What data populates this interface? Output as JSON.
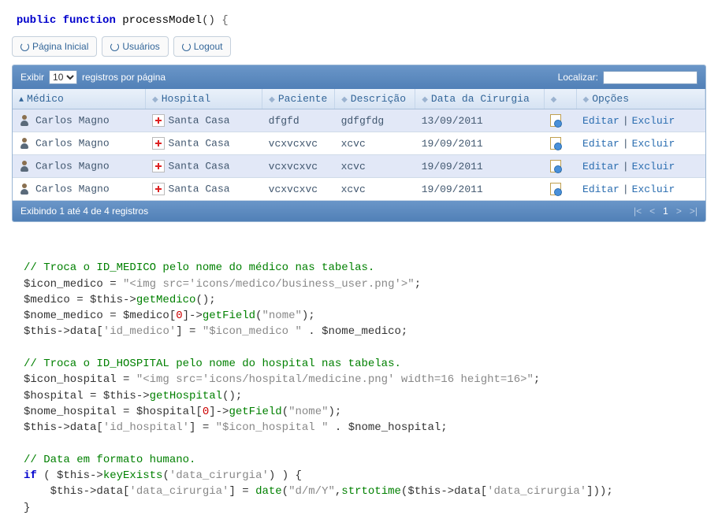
{
  "signature": {
    "public": "public",
    "function": "function",
    "name": "processModel",
    "parens": "()",
    "brace": " {"
  },
  "nav": {
    "home": "Página Inicial",
    "users": "Usuários",
    "logout": "Logout"
  },
  "datatable": {
    "show_label": "Exibir",
    "page_size": "10",
    "per_page": "registros por página",
    "search_label": "Localizar:",
    "search_value": "",
    "headers": {
      "medico": "Médico",
      "hospital": "Hospital",
      "paciente": "Paciente",
      "descricao": "Descrição",
      "data": "Data da Cirurgia",
      "opcoes": "Opções"
    },
    "rows": [
      {
        "medico": "Carlos Magno",
        "hospital": "Santa Casa",
        "paciente": "dfgfd",
        "descricao": "gdfgfdg",
        "data": "13/09/2011",
        "edit": "Editar",
        "del": "Excluir"
      },
      {
        "medico": "Carlos Magno",
        "hospital": "Santa Casa",
        "paciente": "vcxvcxvc",
        "descricao": "xcvc",
        "data": "19/09/2011",
        "edit": "Editar",
        "del": "Excluir"
      },
      {
        "medico": "Carlos Magno",
        "hospital": "Santa Casa",
        "paciente": "vcxvcxvc",
        "descricao": "xcvc",
        "data": "19/09/2011",
        "edit": "Editar",
        "del": "Excluir"
      },
      {
        "medico": "Carlos Magno",
        "hospital": "Santa Casa",
        "paciente": "vcxvcxvc",
        "descricao": "xcvc",
        "data": "19/09/2011",
        "edit": "Editar",
        "del": "Excluir"
      }
    ],
    "footer_info": "Exibindo 1 até 4 de 4 registros",
    "pager": {
      "first": "|<",
      "prev": "<",
      "current": "1",
      "next": ">",
      "last": ">|"
    }
  },
  "code": {
    "l01": "// Troca o ID_MEDICO pelo nome do médico nas tabelas.",
    "l02a": "$icon_medico = ",
    "l02b": "\"<img src='icons/medico/business_user.png'>\"",
    "l02c": ";",
    "l03a": "$medico = $this->",
    "l03b": "getMedico",
    "l03c": "();",
    "l04a": "$nome_medico = $medico[",
    "l04b": "0",
    "l04c": "]->",
    "l04d": "getField",
    "l04e": "(",
    "l04f": "\"nome\"",
    "l04g": ");",
    "l05a": "$this->data[",
    "l05b": "'id_medico'",
    "l05c": "] = ",
    "l05d": "\"$icon_medico \"",
    "l05e": " . $nome_medico;",
    "l06": "",
    "l07": "// Troca o ID_HOSPITAL pelo nome do hospital nas tabelas.",
    "l08a": "$icon_hospital = ",
    "l08b": "\"<img src='icons/hospital/medicine.png' width=16 height=16>\"",
    "l08c": ";",
    "l09a": "$hospital = $this->",
    "l09b": "getHospital",
    "l09c": "();",
    "l10a": "$nome_hospital = $hospital[",
    "l10b": "0",
    "l10c": "]->",
    "l10d": "getField",
    "l10e": "(",
    "l10f": "\"nome\"",
    "l10g": ");",
    "l11a": "$this->data[",
    "l11b": "'id_hospital'",
    "l11c": "] = ",
    "l11d": "\"$icon_hospital \"",
    "l11e": " . $nome_hospital;",
    "l12": "",
    "l13": "// Data em formato humano.",
    "l14a": "if",
    "l14b": " ( $this->",
    "l14c": "keyExists",
    "l14d": "(",
    "l14e": "'data_cirurgia'",
    "l14f": ") ) {",
    "l15a": "    $this->data[",
    "l15b": "'data_cirurgia'",
    "l15c": "] = ",
    "l15d": "date",
    "l15e": "(",
    "l15f": "\"d/m/Y\"",
    "l15g": ",",
    "l15h": "strtotime",
    "l15i": "($this->data[",
    "l15j": "'data_cirurgia'",
    "l15k": "]));",
    "l16": "}"
  }
}
